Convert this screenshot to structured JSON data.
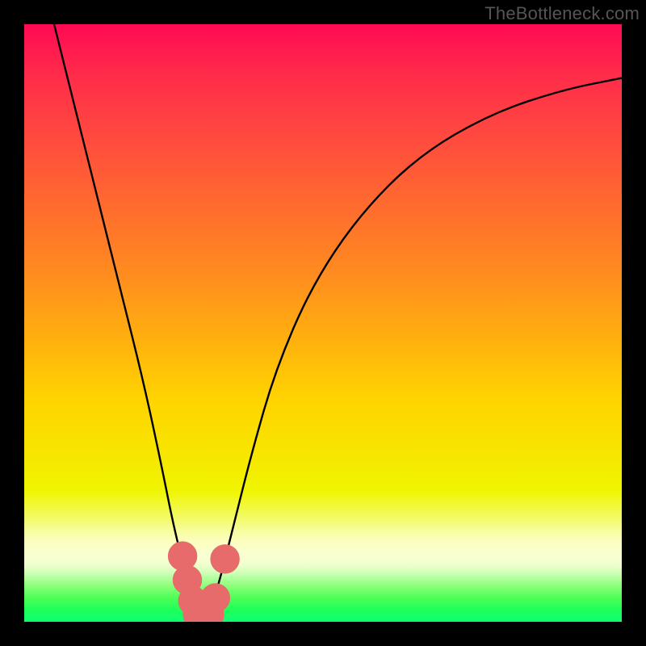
{
  "watermark": "TheBottleneck.com",
  "chart_data": {
    "type": "line",
    "title": "",
    "xlabel": "",
    "ylabel": "",
    "xlim": [
      0,
      100
    ],
    "ylim": [
      0,
      100
    ],
    "grid": false,
    "legend": false,
    "series": [
      {
        "name": "bottleneck-curve",
        "x": [
          5,
          8,
          12,
          16,
          20,
          23,
          25,
          27,
          28.5,
          30,
          31.5,
          33,
          35,
          38,
          42,
          48,
          56,
          66,
          78,
          90,
          100
        ],
        "y": [
          100,
          88,
          72,
          56,
          40,
          26,
          16,
          8,
          3,
          0.5,
          3,
          8,
          16,
          28,
          42,
          56,
          68,
          78,
          85,
          89,
          91
        ]
      }
    ],
    "markers": {
      "name": "highlighted-points",
      "color": "#e86b6b",
      "points": [
        {
          "x": 26.5,
          "y": 11,
          "r": 1.6
        },
        {
          "x": 27.3,
          "y": 7,
          "r": 1.6
        },
        {
          "x": 28.2,
          "y": 3.5,
          "r": 1.6
        },
        {
          "x": 29.0,
          "y": 1.2,
          "r": 1.6
        },
        {
          "x": 30.0,
          "y": 0.5,
          "r": 1.6
        },
        {
          "x": 31.0,
          "y": 1.2,
          "r": 1.6
        },
        {
          "x": 32.0,
          "y": 4.0,
          "r": 1.6
        },
        {
          "x": 33.6,
          "y": 10.5,
          "r": 1.6
        }
      ]
    }
  },
  "colors": {
    "frame": "#000000",
    "top": "#ff0a54",
    "mid": "#ffd400",
    "bottom": "#0eff72",
    "curve": "#000000",
    "marker": "#e86b6b",
    "watermark": "#555555"
  }
}
